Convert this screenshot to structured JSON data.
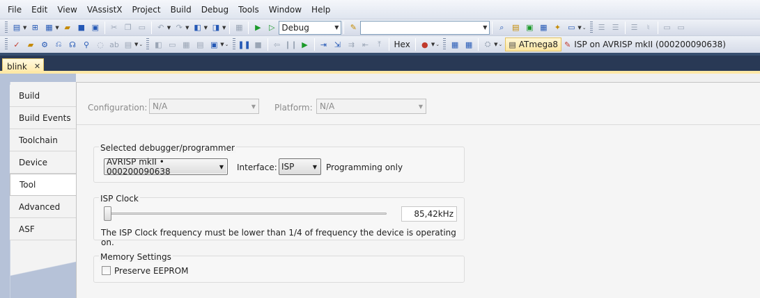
{
  "menu": [
    "File",
    "Edit",
    "View",
    "VAssistX",
    "Project",
    "Build",
    "Debug",
    "Tools",
    "Window",
    "Help"
  ],
  "toolbar1": {
    "config_value": "Debug",
    "find_value": ""
  },
  "toolbar2": {
    "hex_label": "Hex",
    "device": "ATmega8",
    "tool": "ISP on AVRISP mkII (000200090638)"
  },
  "document_tab": "blink",
  "side_tabs": [
    "Build",
    "Build Events",
    "Toolchain",
    "Device",
    "Tool",
    "Advanced",
    "ASF"
  ],
  "active_tab": "Tool",
  "config": {
    "configuration_label": "Configuration:",
    "configuration_value": "N/A",
    "platform_label": "Platform:",
    "platform_value": "N/A"
  },
  "debugger": {
    "title": "Selected debugger/programmer",
    "selected": "AVRISP mkII • 000200090638",
    "interface_label": "Interface:",
    "interface_value": "ISP",
    "mode_text": "Programming only"
  },
  "isp_clock": {
    "title": "ISP Clock",
    "value": "85,42kHz",
    "slider_fraction": 0.0,
    "note": "The ISP Clock frequency must be lower than 1/4 of frequency the device is operating on."
  },
  "memory": {
    "title": "Memory Settings",
    "preserve_eeprom_label": "Preserve EEPROM",
    "preserve_eeprom_checked": false
  }
}
